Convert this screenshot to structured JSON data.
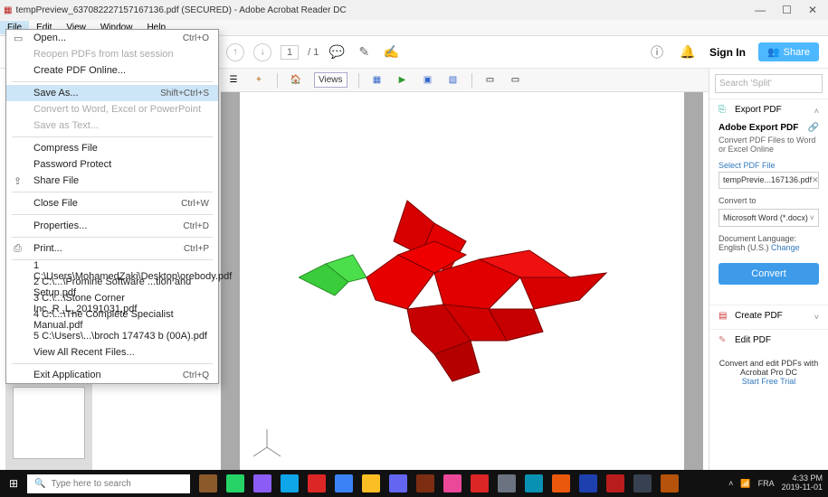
{
  "window": {
    "title": "tempPreview_637082227157167136.pdf (SECURED) - Adobe Acrobat Reader DC",
    "controls": {
      "min": "—",
      "max": "☐",
      "close": "✕"
    }
  },
  "menubar": [
    "File",
    "Edit",
    "View",
    "Window",
    "Help"
  ],
  "file_menu": {
    "open": "Open...",
    "open_sc": "Ctrl+O",
    "reopen": "Reopen PDFs from last session",
    "create_online": "Create PDF Online...",
    "save_as": "Save As...",
    "save_as_sc": "Shift+Ctrl+S",
    "convert_ms": "Convert to Word, Excel or PowerPoint",
    "save_text": "Save as Text...",
    "compress": "Compress File",
    "pw_protect": "Password Protect",
    "share": "Share File",
    "close": "Close File",
    "close_sc": "Ctrl+W",
    "properties": "Properties...",
    "properties_sc": "Ctrl+D",
    "print": "Print...",
    "print_sc": "Ctrl+P",
    "recent": [
      "1 C:\\Users\\MohamedZaki\\Desktop\\orebody.pdf",
      "2 C:\\...\\Promine Software ...tion and Setup.pdf",
      "3 C:\\...\\Stone Corner Inc_R_L_20191031.pdf",
      "4 C:\\...\\The Complete Specialist Manual.pdf",
      "5 C:\\Users\\...\\broch 174743 b (00A).pdf"
    ],
    "view_all": "View All Recent Files...",
    "exit": "Exit Application",
    "exit_sc": "Ctrl+Q"
  },
  "topbar": {
    "page_current": "1",
    "page_total": "/ 1",
    "sign_in": "Sign In",
    "share": "Share"
  },
  "toolbar2": {
    "views": "Views"
  },
  "sidebar": {
    "search_placeholder": "Search 'Split'",
    "export_hdr": "Export PDF",
    "export_title": "Adobe Export PDF",
    "export_sub": "Convert PDF Files to Word or Excel Online",
    "select_label": "Select PDF File",
    "file_name": "tempPrevie...167136.pdf",
    "convert_to_label": "Convert to",
    "convert_target": "Microsoft Word (*.docx)",
    "doc_lang_label": "Document Language:",
    "doc_lang": "English (U.S.)",
    "change": "Change",
    "convert_btn": "Convert",
    "create_hdr": "Create PDF",
    "edit_hdr": "Edit PDF",
    "blurb": "Convert and edit PDFs with Acrobat Pro DC",
    "trial": "Start Free Trial"
  },
  "taskbar": {
    "search_placeholder": "Type here to search",
    "tray": {
      "net_lang": "FRA",
      "time": "4:33 PM",
      "date": "2019-11-01"
    },
    "apps_colors": [
      "#8b5a2b",
      "#25d366",
      "#8b5cf6",
      "#0ea5e9",
      "#dc2626",
      "#3b82f6",
      "#fbbf24",
      "#6366f1",
      "#7c2d12",
      "#ec4899",
      "#dc2626",
      "#6b7280",
      "#0891b2",
      "#ea580c",
      "#1e40af",
      "#b91c1c",
      "#374151",
      "#b45309"
    ]
  }
}
